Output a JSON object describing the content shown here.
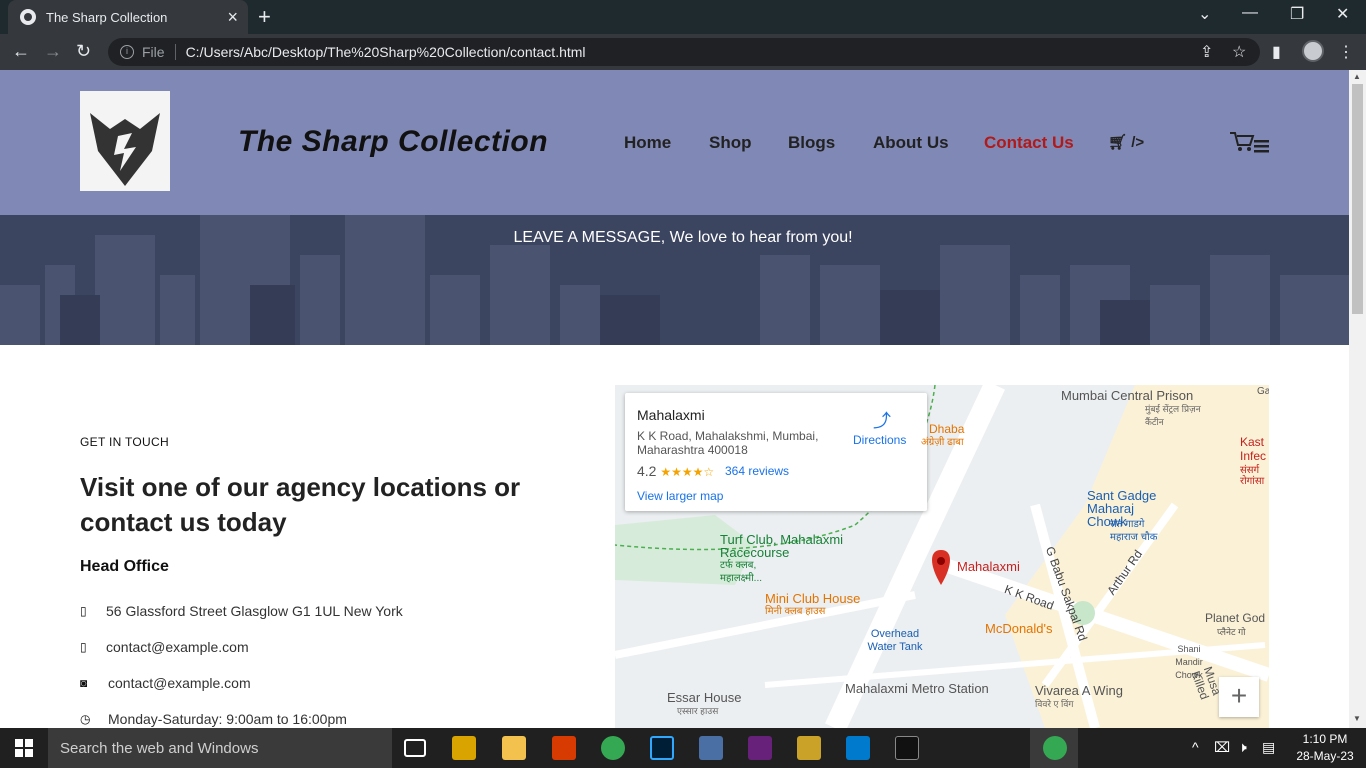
{
  "browser": {
    "tab_title": "The Sharp Collection",
    "tab_close": "×",
    "new_tab": "+",
    "file_label": "File",
    "url": "C:/Users/Abc/Desktop/The%20Sharp%20Collection/contact.html"
  },
  "site": {
    "brand": "The Sharp Collection",
    "nav": [
      "Home",
      "Shop",
      "Blogs",
      "About Us",
      "Contact Us"
    ],
    "nav_extra": "/>",
    "active_nav": "Contact Us"
  },
  "hero": {
    "message": "LEAVE A MESSAGE, We love to hear from you!"
  },
  "contact": {
    "eyebrow": "GET IN TOUCH",
    "heading": "Visit one of our agency locations or contact us today",
    "office_title": "Head Office",
    "address": "56 Glassford Street Glasglow G1 1UL New York",
    "email1": "contact@example.com",
    "email2": "contact@example.com",
    "hours": "Monday-Saturday: 9:00am to 16:00pm"
  },
  "map": {
    "place_name": "Mahalaxmi",
    "place_address": "K K Road, Mahalakshmi, Mumbai, Maharashtra 400018",
    "rating": "4.2",
    "reviews": "364 reviews",
    "directions": "Directions",
    "larger_map": "View larger map",
    "zoom_in": "+",
    "labels": {
      "prison": "Mumbai Central Prison",
      "prison_hi": "मुंबई सेंट्रल प्रिज़न कैंटीन",
      "dhaba": "Dhaba",
      "dhaba_hi": "अंग्रेज़ी ढाबा",
      "kast": "Kast",
      "infec": "Infec",
      "sansarg": "संसर्ग",
      "rogansa": "रोगांसा",
      "santgadge": "Sant Gadge Maharaj Chowk",
      "santgadge_hi": "संत गाडगे महाराज चौक",
      "turf": "Turf Club, Mahalaxmi Racecourse",
      "turf_hi": "टर्फ क्लब, महालक्ष्मी...",
      "mahalaxmi_pin": "Mahalaxmi",
      "gbabu": "G Babu Sakpal Rd",
      "arthur": "Arthur Rd",
      "kkroad": "K K Road",
      "miniclub": "Mini Club House",
      "miniclub_hi": "मिनी क्लब हाउस",
      "mcdonalds": "McDonald's",
      "planetgod": "Planet God",
      "planetgod_hi": "प्लैनेट गो",
      "shanimandir": "Shani Mandir Chowk",
      "overhead": "Overhead Water Tank",
      "essar": "Essar House",
      "essar_hi": "एस्सार हाउस",
      "metro": "Mahalaxmi Metro Station",
      "vivarea": "Vivarea A Wing",
      "vivarea_hi": "विवरे ए विंग",
      "musa": "Musa Killed",
      "ga": "Ga"
    }
  },
  "taskbar": {
    "search_placeholder": "Search the web and Windows",
    "time": "1:10 PM",
    "date": "28-May-23"
  },
  "colors": {
    "header_bg": "#8089b5",
    "hero_bg": "#3c4560",
    "active_nav": "#b01a1a"
  }
}
